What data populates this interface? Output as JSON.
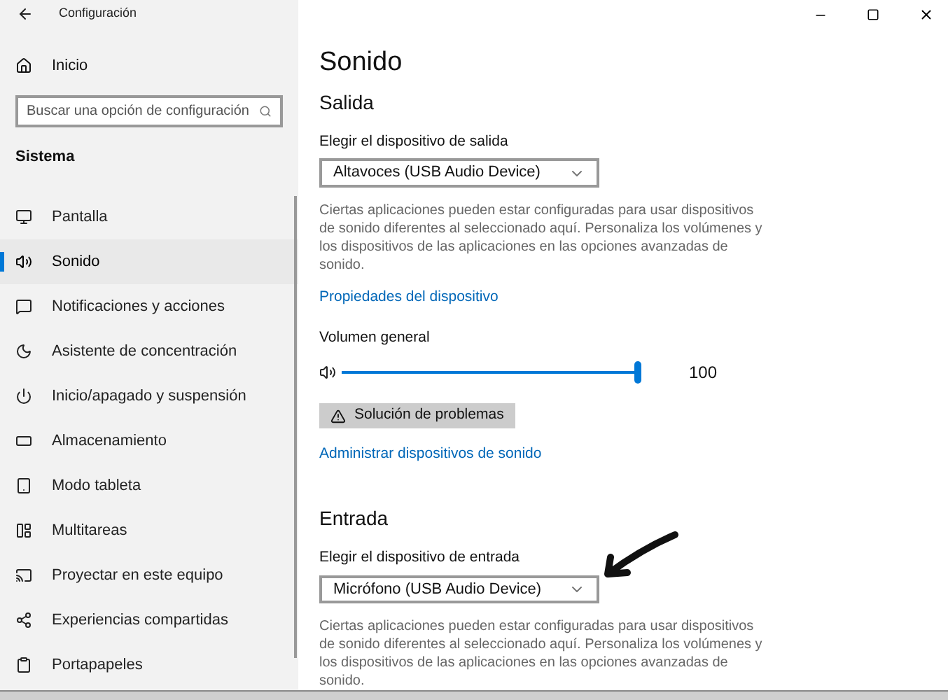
{
  "window": {
    "title": "Configuración"
  },
  "sidebar": {
    "home": "Inicio",
    "search": {
      "placeholder": "Buscar una opción de configuración"
    },
    "section": "Sistema",
    "items": [
      {
        "label": "Pantalla",
        "selected": false
      },
      {
        "label": "Sonido",
        "selected": true
      },
      {
        "label": "Notificaciones y acciones",
        "selected": false
      },
      {
        "label": "Asistente de concentración",
        "selected": false
      },
      {
        "label": "Inicio/apagado y suspensión",
        "selected": false
      },
      {
        "label": "Almacenamiento",
        "selected": false
      },
      {
        "label": "Modo tableta",
        "selected": false
      },
      {
        "label": "Multitareas",
        "selected": false
      },
      {
        "label": "Proyectar en este equipo",
        "selected": false
      },
      {
        "label": "Experiencias compartidas",
        "selected": false
      },
      {
        "label": "Portapapeles",
        "selected": false
      }
    ]
  },
  "page": {
    "title": "Sonido",
    "output": {
      "heading": "Salida",
      "label": "Elegir el dispositivo de salida",
      "device": "Altavoces (USB Audio Device)",
      "description": "Ciertas aplicaciones pueden estar configuradas para usar dispositivos de sonido diferentes al seleccionado aquí. Personaliza los volúmenes y los dispositivos de las aplicaciones en las opciones avanzadas de sonido.",
      "properties_link": "Propiedades del dispositivo",
      "volume_label": "Volumen general",
      "volume": {
        "level": 1.0,
        "reading": "100"
      },
      "troubleshoot_button": "Solución de problemas",
      "manage_link": "Administrar dispositivos de sonido"
    },
    "input": {
      "heading": "Entrada",
      "label": "Elegir el dispositivo de entrada",
      "device": "Micrófono (USB Audio Device)",
      "description": "Ciertas aplicaciones pueden estar configuradas para usar dispositivos de sonido diferentes al seleccionado aquí. Personaliza los volúmenes y los dispositivos de las aplicaciones en las opciones avanzadas de sonido."
    }
  }
}
